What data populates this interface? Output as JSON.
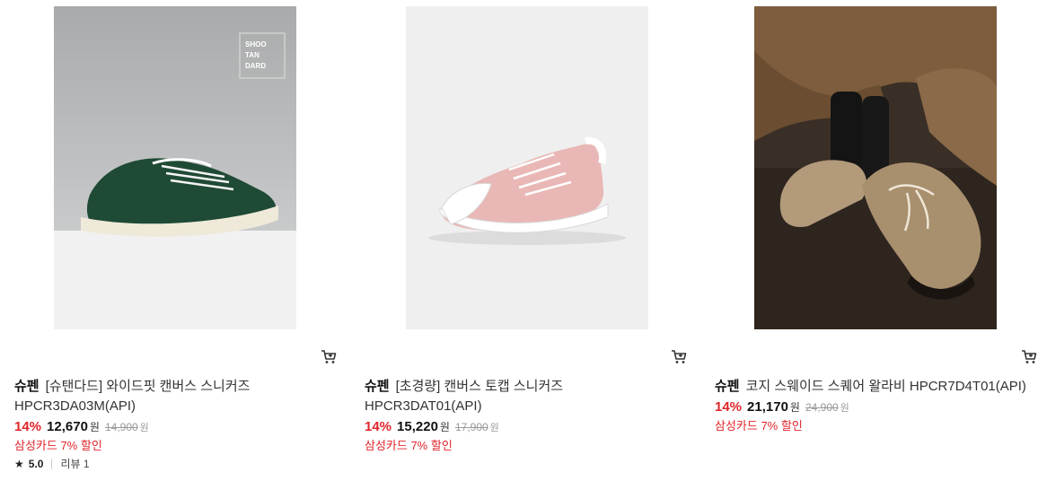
{
  "products": [
    {
      "brand": "슈펜",
      "name": "[슈탠다드] 와이드핏 캔버스 스니커즈",
      "code": "HPCR3DA03M(API)",
      "discount": "14%",
      "price": "12,670",
      "currency": "원",
      "original_price": "14,900",
      "card_benefit": "삼성카드 7% 할인",
      "rating": "5.0",
      "review_label": "리뷰",
      "review_count": "1",
      "image_alt": "green canvas sneaker",
      "badge_lines": [
        "SHOO",
        "TAN",
        "DARD"
      ]
    },
    {
      "brand": "슈펜",
      "name": "[초경량] 캔버스 토캡 스니커즈",
      "code": "HPCR3DAT01(API)",
      "discount": "14%",
      "price": "15,220",
      "currency": "원",
      "original_price": "17,900",
      "card_benefit": "삼성카드 7% 할인",
      "image_alt": "pink canvas toe-cap sneaker"
    },
    {
      "brand": "슈펜",
      "name": "코지 스웨이드 스퀘어 왈라비 HPCR7D4T01(API)",
      "discount": "14%",
      "price": "21,170",
      "currency": "원",
      "original_price": "24,900",
      "card_benefit": "삼성카드 7% 할인",
      "image_alt": "beige suede wallabee shoe"
    }
  ],
  "icons": {
    "cart": "cart-icon",
    "star": "star-icon"
  },
  "colors": {
    "discount": "#e0252b",
    "benefit": "#e0252b"
  }
}
